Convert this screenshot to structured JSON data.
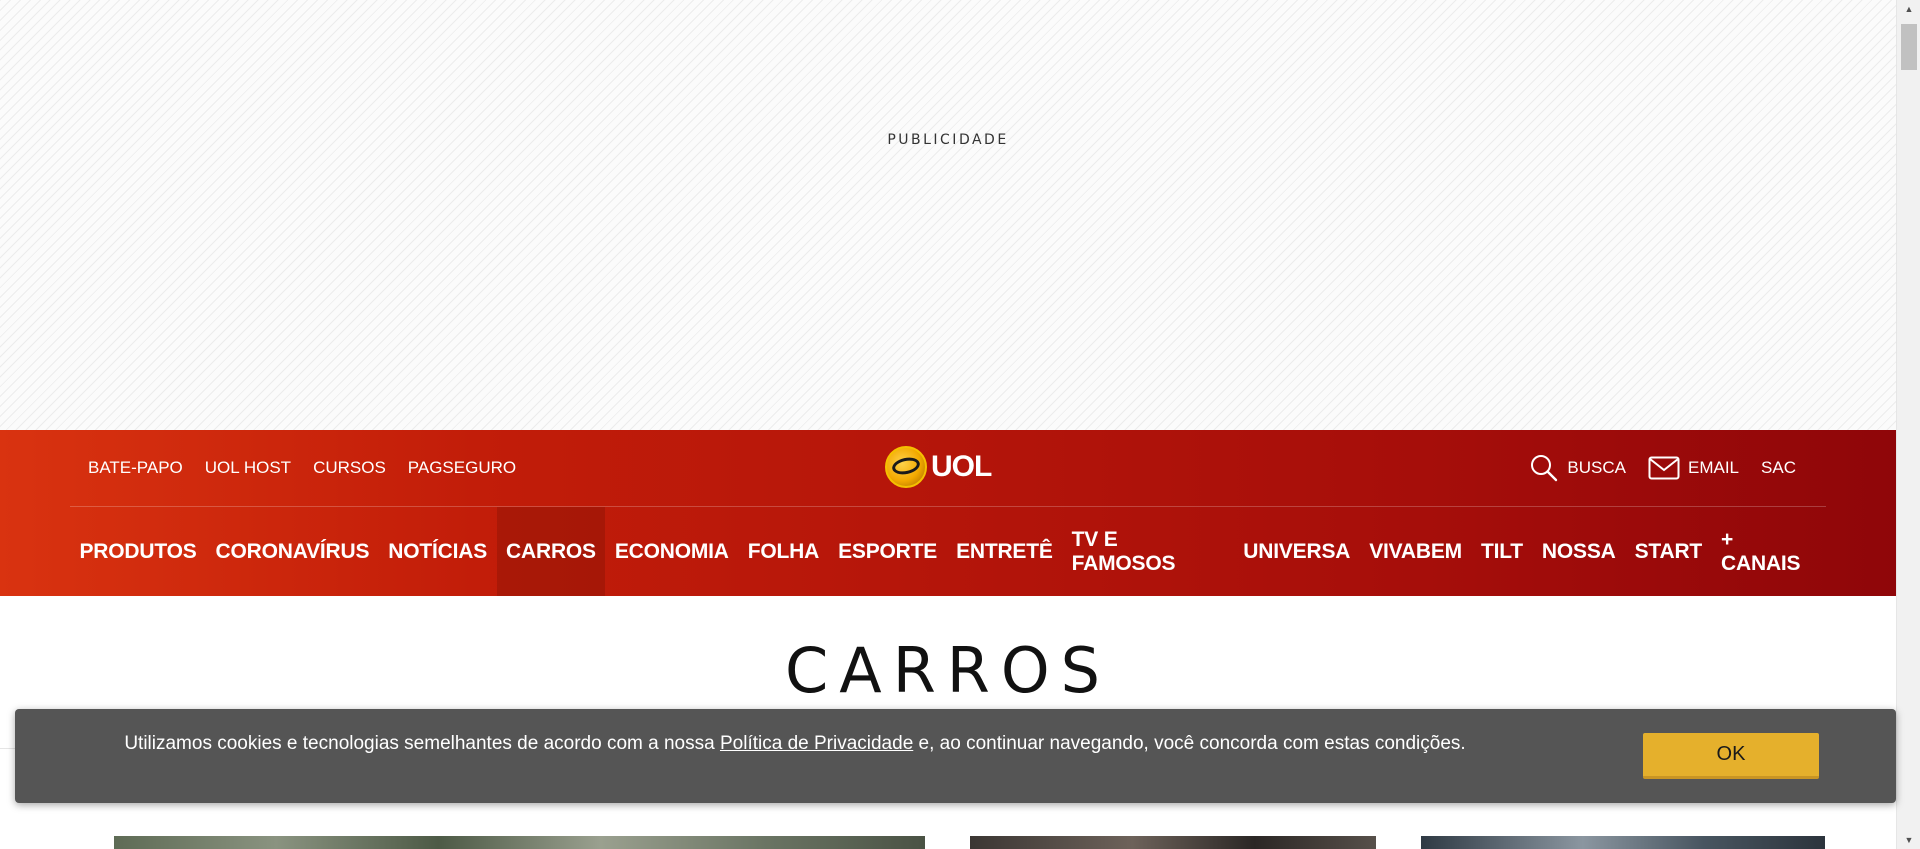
{
  "ad": {
    "label": "PUBLICIDADE"
  },
  "header": {
    "top_links": [
      "BATE-PAPO",
      "UOL HOST",
      "CURSOS",
      "PAGSEGURO"
    ],
    "logo_text": "UOL",
    "search_label": "BUSCA",
    "email_label": "EMAIL",
    "sac_label": "SAC",
    "nav": [
      "PRODUTOS",
      "CORONAVÍRUS",
      "NOTÍCIAS",
      "CARROS",
      "ECONOMIA",
      "FOLHA",
      "ESPORTE",
      "ENTRETÊ",
      "TV E FAMOSOS",
      "UNIVERSA",
      "VIVABEM",
      "TILT",
      "NOSSA",
      "START",
      "+ CANAIS"
    ],
    "active_nav": "CARROS"
  },
  "section": {
    "title": "CARROS"
  },
  "cookie": {
    "text_before": "Utilizamos cookies e tecnologias semelhantes de acordo com a nossa ",
    "link": "Política de Privacidade",
    "text_after": " e, ao continuar navegando, você concorda com estas condições.",
    "ok_label": "OK"
  },
  "colors": {
    "header_start": "#d93310",
    "header_end": "#8f0609",
    "cookie_bg": "#555555",
    "ok_button": "#e5b02c"
  }
}
